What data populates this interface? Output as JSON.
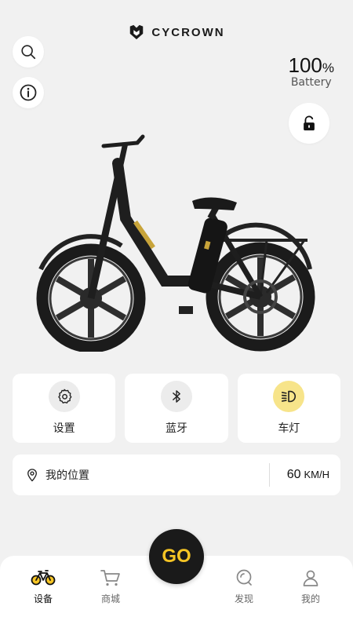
{
  "brand": {
    "name": "CYCROWN"
  },
  "battery": {
    "value": "100",
    "unit": "%",
    "label": "Battery"
  },
  "tiles": [
    {
      "label": "设置",
      "icon": "gear-icon"
    },
    {
      "label": "蓝牙",
      "icon": "bluetooth-icon"
    },
    {
      "label": "车灯",
      "icon": "headlight-icon"
    }
  ],
  "location": {
    "label": "我的位置",
    "speed": "60",
    "speed_unit": "KM/H"
  },
  "go": {
    "label": "GO"
  },
  "tabs": [
    {
      "label": "设备",
      "icon": "bicycle-icon",
      "active": true
    },
    {
      "label": "商城",
      "icon": "cart-icon"
    },
    {
      "label": "发现",
      "icon": "discover-icon"
    },
    {
      "label": "我的",
      "icon": "user-icon"
    }
  ],
  "colors": {
    "accent": "#f6c525",
    "background": "#f1f1f1",
    "go_button": "#1a1a1a"
  }
}
